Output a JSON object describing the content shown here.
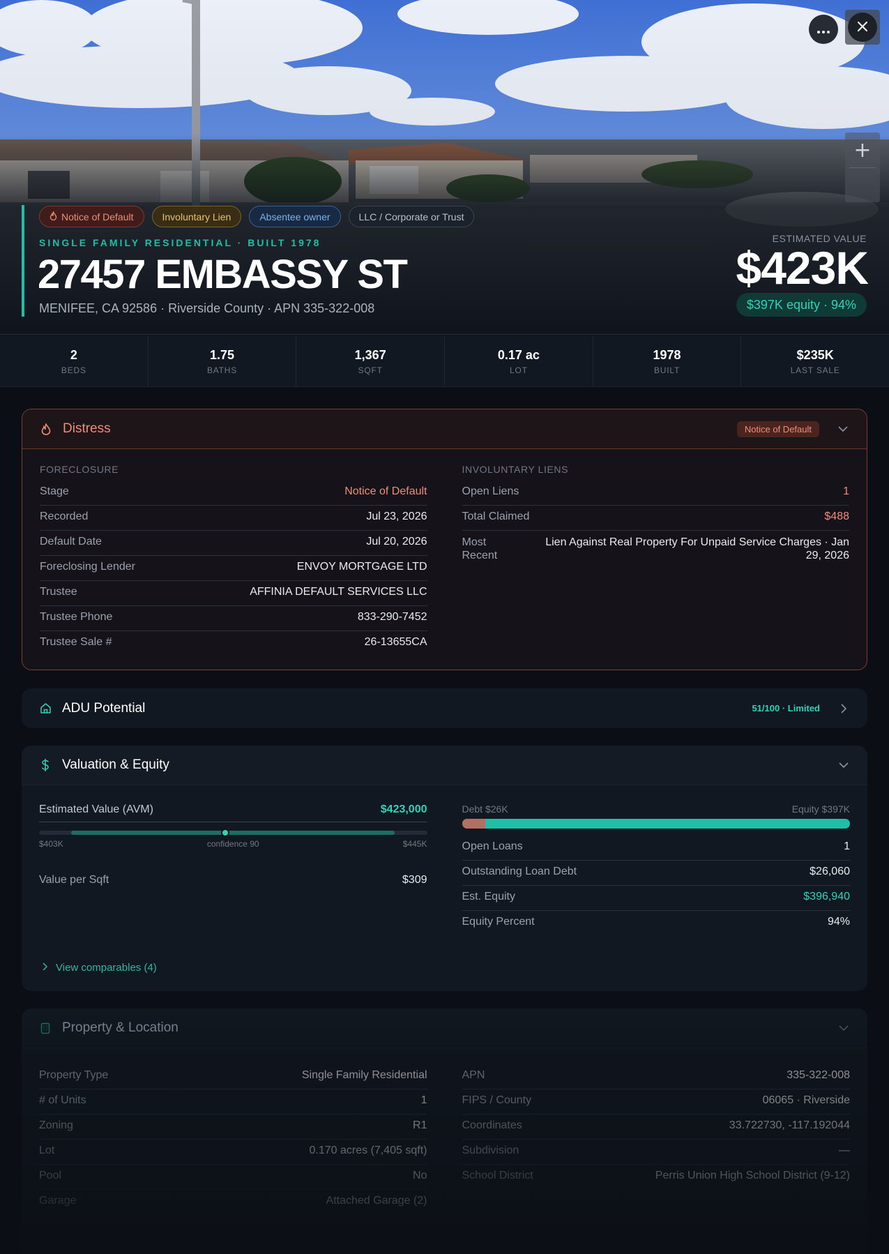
{
  "hero": {
    "chips": [
      {
        "label": "Notice of Default",
        "style": "red",
        "icon": "flame-icon"
      },
      {
        "label": "Involuntary Lien",
        "style": "amber"
      },
      {
        "label": "Absentee owner",
        "style": "blue"
      },
      {
        "label": "LLC / Corporate or Trust",
        "style": "gray"
      }
    ],
    "eyebrow": "SINGLE FAMILY RESIDENTIAL · BUILT 1978",
    "address": "27457 EMBASSY ST",
    "subaddress": "MENIFEE, CA 92586 · Riverside County · APN 335-322-008",
    "estimated_label": "ESTIMATED VALUE",
    "estimated_value": "$423K",
    "equity_pill": "$397K equity · 94%",
    "actions": {
      "more_icon": "ellipsis-icon",
      "close_icon": "close-icon",
      "zoom_in": "+"
    }
  },
  "stats": [
    {
      "value": "2",
      "label": "BEDS"
    },
    {
      "value": "1.75",
      "label": "BATHS"
    },
    {
      "value": "1,367",
      "label": "SQFT"
    },
    {
      "value": "0.17 ac",
      "label": "LOT"
    },
    {
      "value": "1978",
      "label": "BUILT"
    },
    {
      "value": "$235K",
      "label": "LAST SALE"
    }
  ],
  "distress": {
    "title": "Distress",
    "badge": "Notice of Default",
    "foreclosure_label": "FORECLOSURE",
    "foreclosure": [
      {
        "key": "Stage",
        "value": "Notice of Default",
        "tone": "red"
      },
      {
        "key": "Recorded",
        "value": "Jul 23, 2026"
      },
      {
        "key": "Default Date",
        "value": "Jul 20, 2026"
      },
      {
        "key": "Foreclosing Lender",
        "value": "ENVOY MORTGAGE LTD"
      },
      {
        "key": "Trustee",
        "value": "AFFINIA DEFAULT SERVICES LLC"
      },
      {
        "key": "Trustee Phone",
        "value": "833-290-7452"
      },
      {
        "key": "Trustee Sale #",
        "value": "26-13655CA"
      }
    ],
    "liens_label": "INVOLUNTARY LIENS",
    "liens": [
      {
        "key": "Open Liens",
        "value": "1",
        "tone": "red"
      },
      {
        "key": "Total Claimed",
        "value": "$488",
        "tone": "red"
      },
      {
        "key": "Most Recent",
        "value": "Lien Against Real Property For Unpaid Service Charges · Jan 29, 2026"
      }
    ]
  },
  "adu": {
    "title": "ADU Potential",
    "score": "51/100 · Limited"
  },
  "valuation": {
    "title": "Valuation & Equity",
    "avm_label": "Estimated Value (AVM)",
    "avm_value": "$423,000",
    "range_low": "$403K",
    "range_high": "$445K",
    "confidence": "confidence 90",
    "range_low_num": 403000,
    "range_high_num": 445000,
    "avm_num": 423000,
    "value_per_sqft_label": "Value per Sqft",
    "value_per_sqft": "$309",
    "debt_label": "Debt $26K",
    "equity_label": "Equity $397K",
    "debt_fraction": 0.06,
    "rows": [
      {
        "key": "Open Loans",
        "value": "1"
      },
      {
        "key": "Outstanding Loan Debt",
        "value": "$26,060"
      },
      {
        "key": "Est. Equity",
        "value": "$396,940",
        "tone": "teal"
      },
      {
        "key": "Equity Percent",
        "value": "94%"
      }
    ],
    "comparables_link": "View comparables (4)"
  },
  "property": {
    "title": "Property & Location",
    "left": [
      {
        "key": "Property Type",
        "value": "Single Family Residential"
      },
      {
        "key": "# of Units",
        "value": "1"
      },
      {
        "key": "Zoning",
        "value": "R1"
      },
      {
        "key": "Lot",
        "value": "0.170 acres (7,405 sqft)"
      },
      {
        "key": "Pool",
        "value": "No"
      },
      {
        "key": "Garage",
        "value": "Attached Garage (2)"
      }
    ],
    "right": [
      {
        "key": "APN",
        "value": "335-322-008"
      },
      {
        "key": "FIPS / County",
        "value": "06065 · Riverside"
      },
      {
        "key": "Coordinates",
        "value": "33.722730, -117.192044"
      },
      {
        "key": "Subdivision",
        "value": "—"
      },
      {
        "key": "School District",
        "value": "Perris Union High School District (9-12)"
      }
    ]
  },
  "colors": {
    "accent": "#1fbfa7",
    "danger": "#f08c78",
    "warning": "#eac06a",
    "info": "#7fb0f0"
  }
}
